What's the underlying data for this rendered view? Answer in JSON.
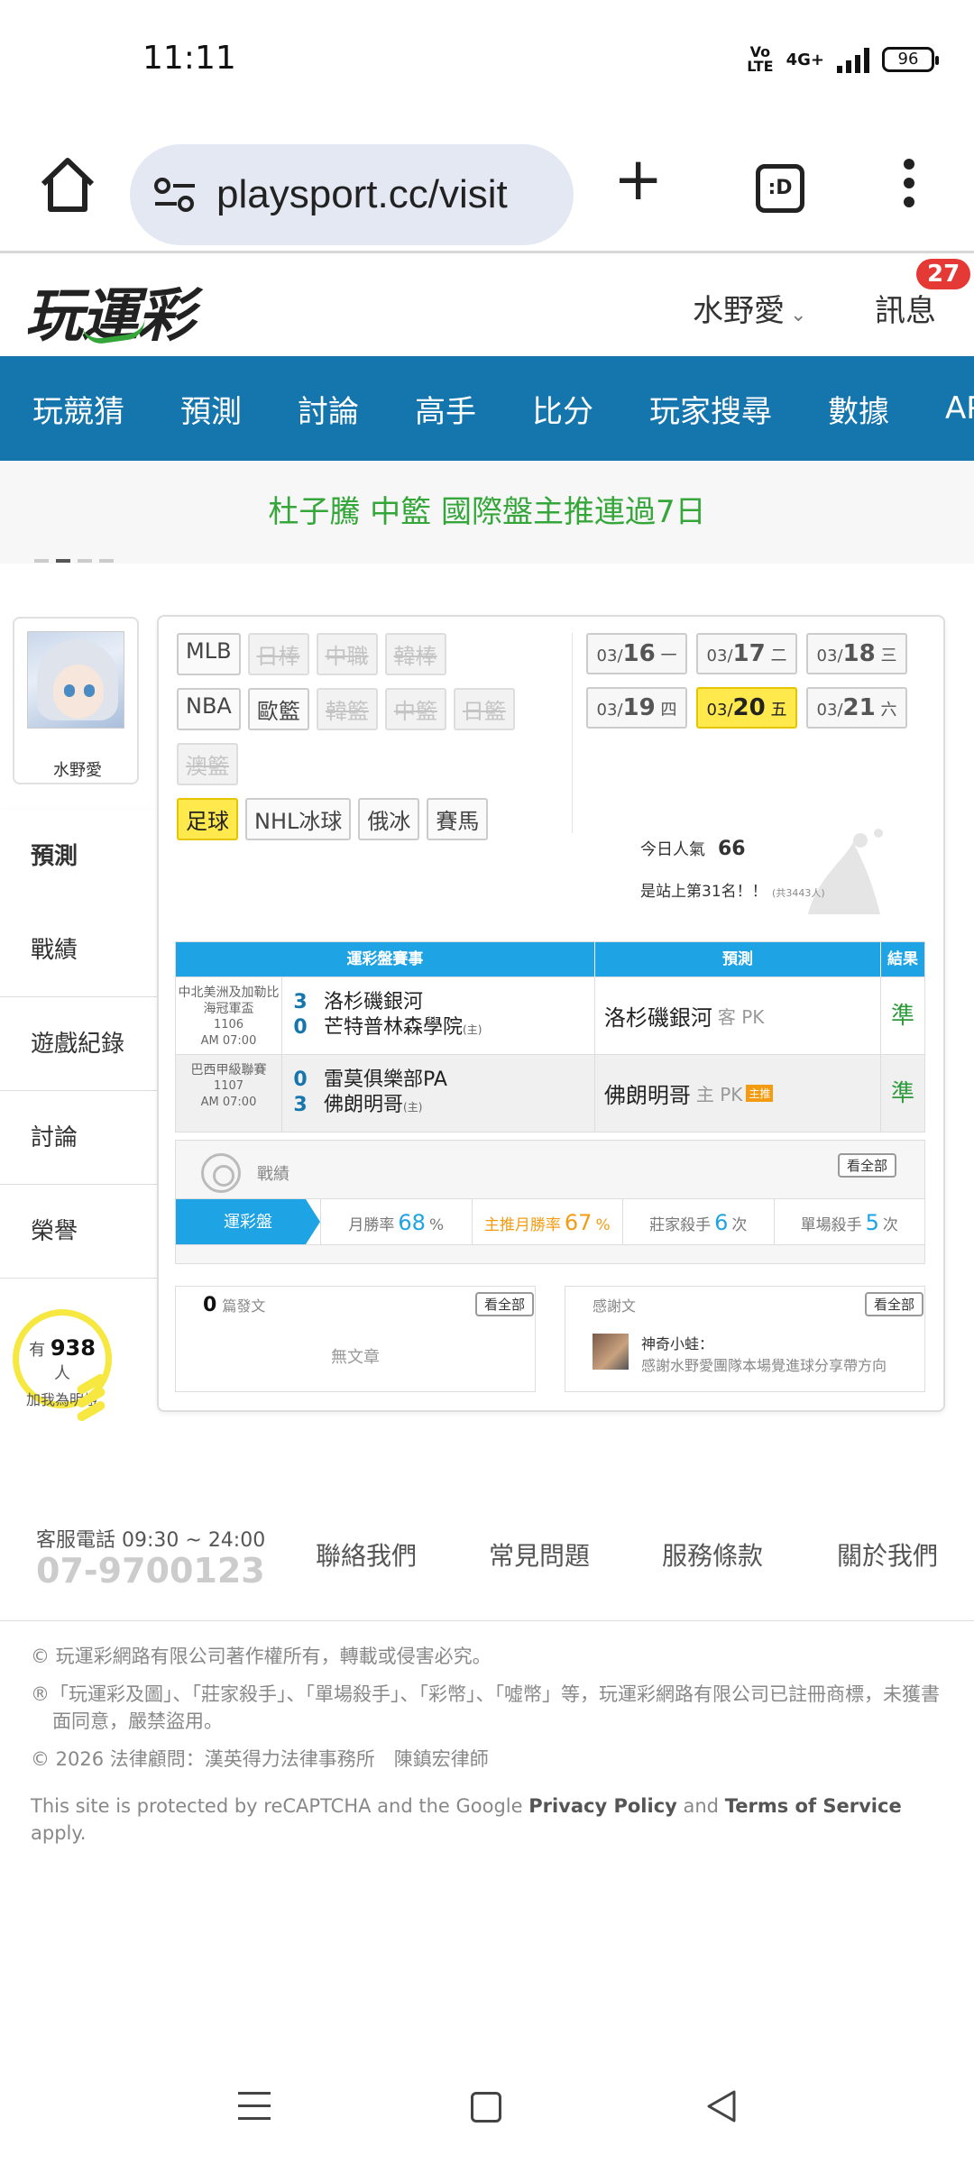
{
  "status": {
    "time": "11:11",
    "volte": "Vo\nLTE",
    "network": "4G+",
    "battery": "96"
  },
  "browser": {
    "url": "playsport.cc/visit",
    "tab_icon": ":D",
    "home_icon": "home-icon",
    "menu_icon": "more-vert-icon"
  },
  "header": {
    "logo": "玩運彩",
    "username": "水野愛",
    "chevron": "⌄",
    "messages_label": "訊息",
    "messages_count": "27"
  },
  "nav": {
    "items": [
      "玩競猜",
      "預測",
      "討論",
      "高手",
      "比分",
      "玩家搜尋",
      "數據",
      "APP"
    ]
  },
  "banner": {
    "text": "杜子騰 中籃 國際盤主推連過7日"
  },
  "profile": {
    "name": "水野愛",
    "fans_prefix": "有",
    "fans_count": "938",
    "fans_suffix": "人",
    "fans_caption": "加我為明燈"
  },
  "sidemenu": {
    "items": [
      "預測",
      "戰績",
      "遊戲紀錄",
      "討論",
      "榮譽"
    ]
  },
  "leagues": {
    "row1": [
      {
        "label": "MLB",
        "state": "normal"
      },
      {
        "label": "日棒",
        "state": "disabled"
      },
      {
        "label": "中職",
        "state": "disabled"
      },
      {
        "label": "韓棒",
        "state": "disabled"
      }
    ],
    "row2": [
      {
        "label": "NBA",
        "state": "normal"
      },
      {
        "label": "歐籃",
        "state": "normal"
      },
      {
        "label": "韓籃",
        "state": "disabled"
      },
      {
        "label": "中籃",
        "state": "disabled"
      },
      {
        "label": "日籃",
        "state": "disabled"
      }
    ],
    "row3": [
      {
        "label": "澳籃",
        "state": "disabled"
      }
    ],
    "row4": [
      {
        "label": "足球",
        "state": "active"
      },
      {
        "label": "NHL冰球",
        "state": "normal"
      },
      {
        "label": "俄冰",
        "state": "normal"
      },
      {
        "label": "賽馬",
        "state": "normal"
      }
    ]
  },
  "dates": [
    {
      "md": "03/",
      "d": "16",
      "wd": "一"
    },
    {
      "md": "03/",
      "d": "17",
      "wd": "二"
    },
    {
      "md": "03/",
      "d": "18",
      "wd": "三"
    },
    {
      "md": "03/",
      "d": "19",
      "wd": "四"
    },
    {
      "md": "03/",
      "d": "20",
      "wd": "五",
      "active": true
    },
    {
      "md": "03/",
      "d": "21",
      "wd": "六"
    }
  ],
  "popularity": {
    "label": "今日人氣",
    "value": "66",
    "rank_text": "是站上第31名！！",
    "rank_total": "(共3443人)"
  },
  "table": {
    "headers": [
      "運彩盤賽事",
      "預測",
      "結果"
    ],
    "rows": [
      {
        "league": "中北美洲及加勒比海冠軍盃",
        "num": "1106",
        "time": "AM 07:00",
        "score1": "3",
        "score2": "0",
        "team1": "洛杉磯銀河",
        "team2": "芒特普林森學院",
        "team2_tag": "(主)",
        "pick": "洛杉磯銀河",
        "pick_side": "客 PK",
        "result": "準"
      },
      {
        "league": "巴西甲級聯賽",
        "num": "1107",
        "time": "AM 07:00",
        "score1": "0",
        "score2": "3",
        "team1": "雷莫俱樂部PA",
        "team2": "佛朗明哥",
        "team2_tag": "(主)",
        "pick": "佛朗明哥",
        "pick_side": "主 PK",
        "pick_badge": "主推",
        "result": "準"
      }
    ]
  },
  "record": {
    "title": "戰績",
    "view_all": "看全部",
    "first": "運彩盤",
    "stats": [
      {
        "label": "月勝率",
        "value": "68",
        "unit": "%",
        "color": "blue"
      },
      {
        "label": "主推月勝率",
        "value": "67",
        "unit": "%",
        "color": "orange"
      },
      {
        "label": "莊家殺手",
        "value": "6",
        "unit": "次",
        "color": "blue"
      },
      {
        "label": "單場殺手",
        "value": "5",
        "unit": "次",
        "color": "blue"
      }
    ]
  },
  "posts": {
    "count": "0",
    "label": "篇發文",
    "view_all": "看全部",
    "empty": "無文章"
  },
  "thanks": {
    "label": "感謝文",
    "view_all": "看全部",
    "author": "神奇小蛙：",
    "text": "感謝水野愛團隊本場覺進球分享帶方向"
  },
  "footer": {
    "cs_label": "客服電話 09:30 ~ 24:00",
    "phone": "07-9700123",
    "links": [
      "聯絡我們",
      "常見問題",
      "服務條款",
      "關於我們"
    ],
    "copyright": "© 玩運彩網路有限公司著作權所有，轉載或侵害必究。",
    "trademark": "®「玩運彩及圖」、「莊家殺手」、「單場殺手」、「彩幣」、「噓幣」等，玩運彩網路有限公司已註冊商標，未獲書面同意，嚴禁盜用。",
    "lawyer": "© 2026 法律顧問：漢英得力法律事務所　陳鎮宏律師",
    "captcha_a": "This site is protected by reCAPTCHA and the Google ",
    "privacy": "Privacy Policy",
    "captcha_and": " and ",
    "terms": "Terms of Service",
    "captcha_b": " apply."
  }
}
